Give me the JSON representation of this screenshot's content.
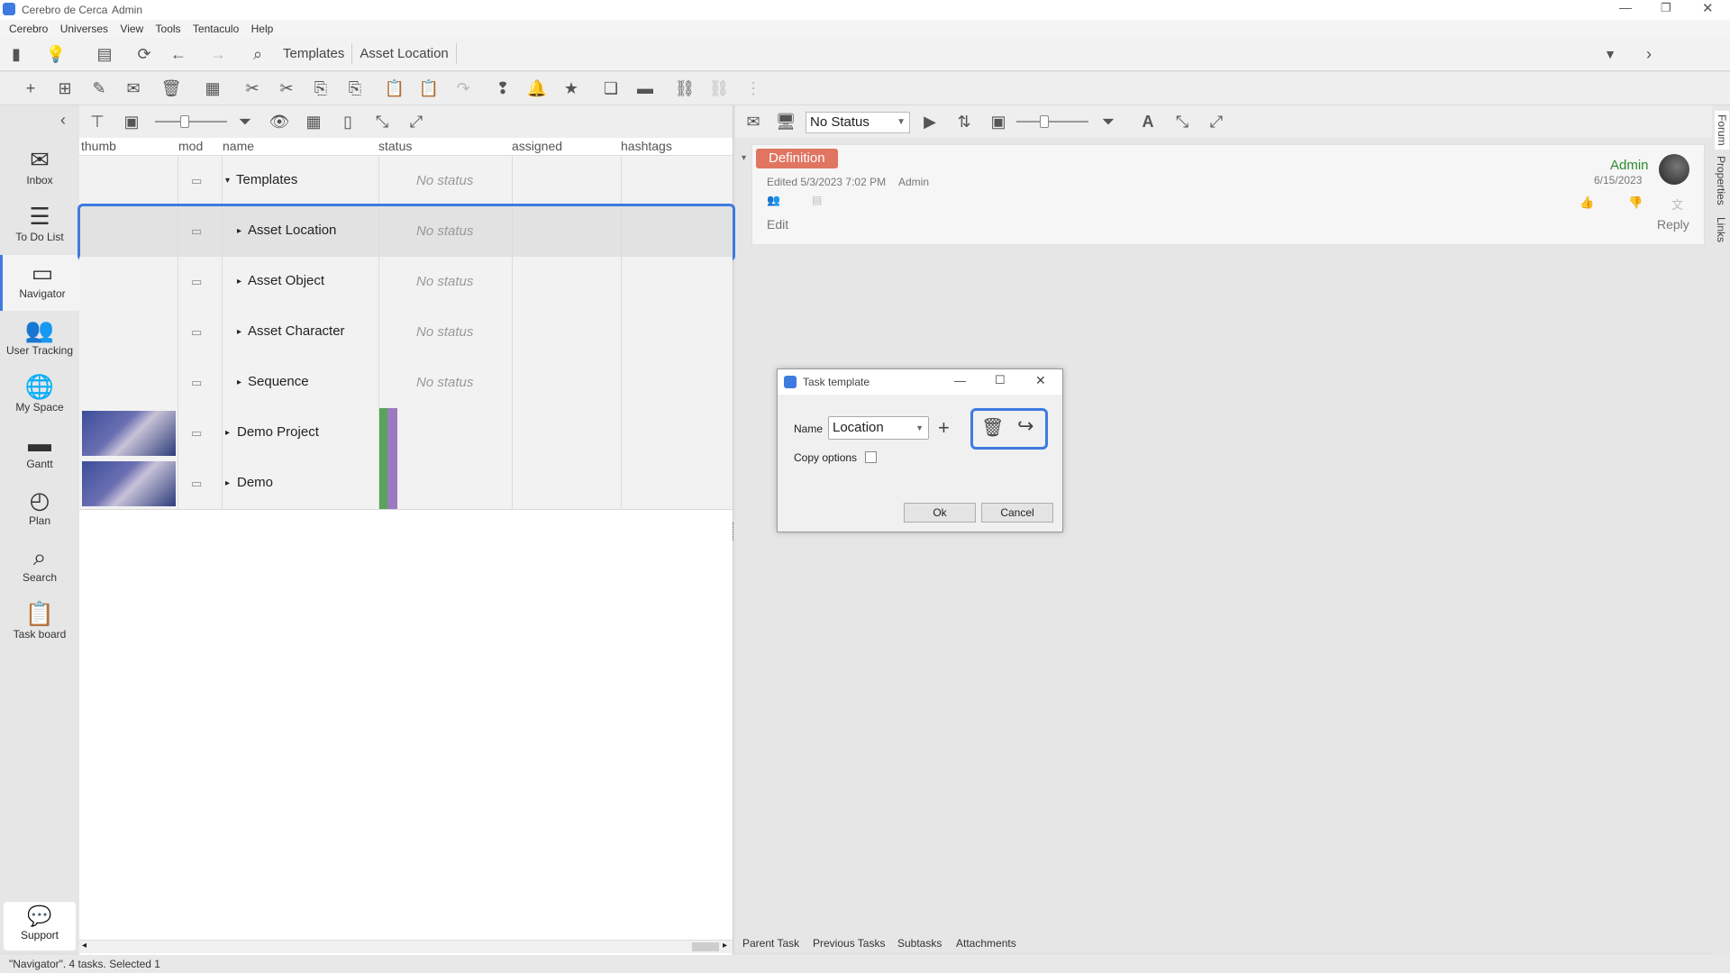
{
  "window": {
    "title": "Cerebro de Cerca",
    "user": "Admin"
  },
  "menu": [
    "Cerebro",
    "Universes",
    "View",
    "Tools",
    "Tentaculo",
    "Help"
  ],
  "breadcrumb": [
    "Templates",
    "Asset Location"
  ],
  "sidebar": {
    "items": [
      {
        "label": "Inbox",
        "icon": "✉"
      },
      {
        "label": "To Do List",
        "icon": "☰"
      },
      {
        "label": "Navigator",
        "icon": "▭"
      },
      {
        "label": "User Tracking",
        "icon": "👥"
      },
      {
        "label": "My Space",
        "icon": "🌐"
      },
      {
        "label": "Gantt",
        "icon": "▬"
      },
      {
        "label": "Plan",
        "icon": "◴"
      },
      {
        "label": "Search",
        "icon": "⌕"
      },
      {
        "label": "Task board",
        "icon": "📋"
      }
    ],
    "support": "Support"
  },
  "table": {
    "columns": [
      "thumb",
      "mod",
      "name",
      "status",
      "assigned",
      "hashtags"
    ],
    "rows": [
      {
        "name": "Templates",
        "status": "No status"
      },
      {
        "name": "Asset Location",
        "status": "No status"
      },
      {
        "name": "Asset Object",
        "status": "No status"
      },
      {
        "name": "Asset Character",
        "status": "No status"
      },
      {
        "name": "Sequence",
        "status": "No status"
      },
      {
        "name": "Demo Project",
        "status": ""
      },
      {
        "name": "Demo",
        "status": ""
      }
    ]
  },
  "right_toolbar": {
    "status_select": "No Status"
  },
  "definition": {
    "badge": "Definition",
    "edited": "Edited 5/3/2023 7:02 PM",
    "edited_by": "Admin",
    "author": "Admin",
    "date": "6/15/2023",
    "edit": "Edit",
    "reply": "Reply"
  },
  "right_tabs": [
    "Parent Task",
    "Previous Tasks",
    "Subtasks",
    "Attachments"
  ],
  "vertical_tabs": [
    "Forum",
    "Properties",
    "Links"
  ],
  "dialog": {
    "title": "Task template",
    "name_label": "Name",
    "name_value": "Location",
    "copy_options": "Copy options",
    "ok": "Ok",
    "cancel": "Cancel"
  },
  "status_bar": "\"Navigator\". 4 tasks. Selected 1",
  "colors": {
    "accent": "#3d7be0",
    "badge": "#e07561",
    "author": "#2e8b2e"
  }
}
